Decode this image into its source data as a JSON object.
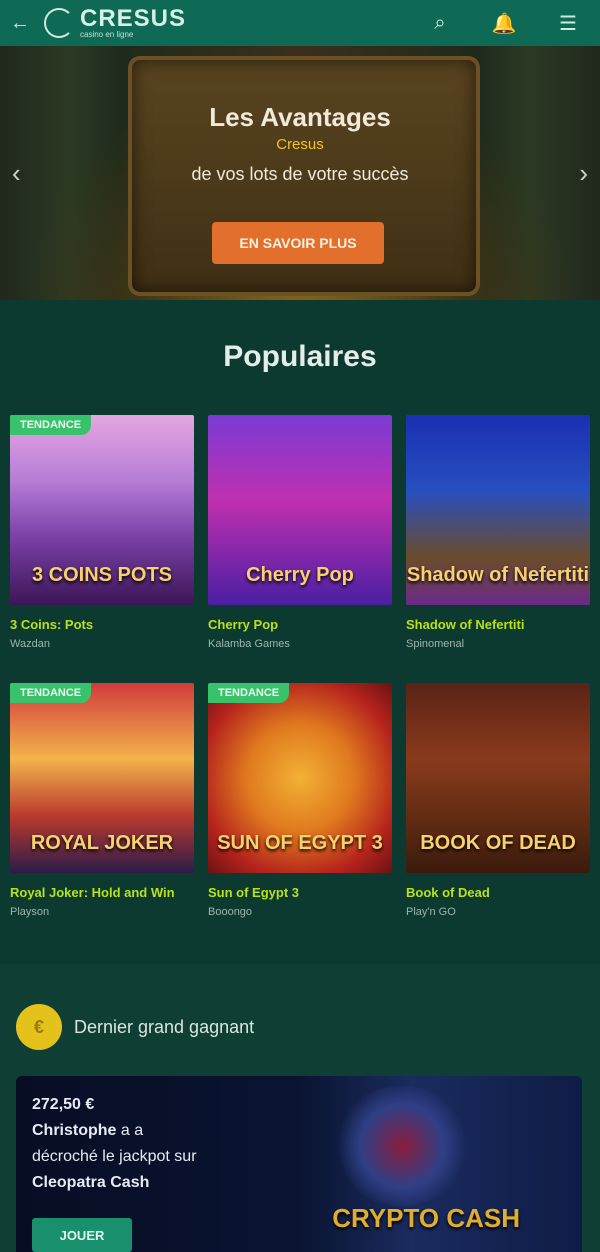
{
  "header": {
    "back_icon": "arrow-left-icon",
    "logo_name": "CRESUS",
    "logo_sub": "casino en ligne",
    "icons": [
      "search-icon",
      "notification-icon",
      "menu-icon"
    ]
  },
  "hero": {
    "title": "Les Avantages",
    "subtitle": "Cresus",
    "line": "de vos lots de votre succès",
    "button_label": "EN SAVOIR PLUS"
  },
  "popular": {
    "title": "Populaires",
    "games": [
      {
        "badge": "TENDANCE",
        "title": "3 Coins: Pots",
        "provider": "Wazdan",
        "art": "3 COINS POTS"
      },
      {
        "badge": "",
        "title": "Cherry Pop",
        "provider": "Kalamba Games",
        "art": "Cherry Pop"
      },
      {
        "badge": "",
        "title": "Shadow of Nefertiti",
        "provider": "Spinomenal",
        "art": "Shadow of Nefertiti"
      },
      {
        "badge": "TENDANCE",
        "title": "Royal Joker: Hold and Win",
        "provider": "Playson",
        "art": "ROYAL JOKER"
      },
      {
        "badge": "TENDANCE",
        "title": "Sun of Egypt 3",
        "provider": "Booongo",
        "art": "SUN OF EGYPT 3"
      },
      {
        "badge": "",
        "title": "Book of Dead",
        "provider": "Play'n GO",
        "art": "BOOK OF DEAD"
      }
    ]
  },
  "winner": {
    "title": "Dernier grand gagnant",
    "coin_symbol": "€",
    "amount": "272,50 €",
    "name": "Christophe",
    "text_a": "a a décroché le jackpot sur",
    "game": "Cleopatra Cash",
    "button_label": "JOUER",
    "game_art": "CRYPTO CASH"
  }
}
